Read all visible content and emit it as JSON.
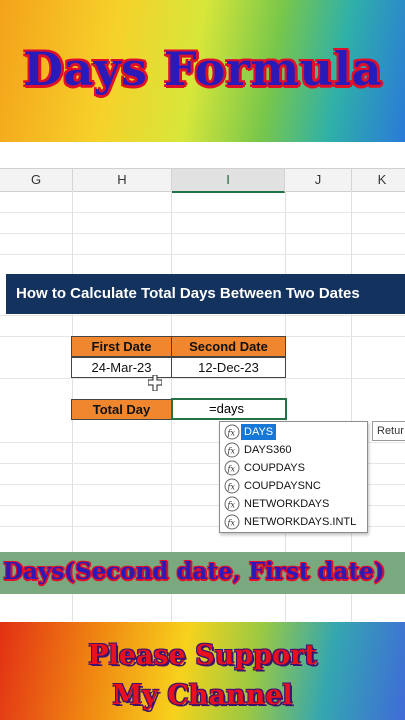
{
  "banner_top": {
    "title": "Days Formula"
  },
  "sheet": {
    "columns": [
      {
        "label": "G"
      },
      {
        "label": "H"
      },
      {
        "label": "I",
        "active": true
      },
      {
        "label": "J"
      },
      {
        "label": "K"
      }
    ],
    "title_band": "How to Calculate Total Days Between Two Dates",
    "first_date_header": "First Date",
    "second_date_header": "Second Date",
    "first_date_value": "24-Mar-23",
    "second_date_value": "12-Dec-23",
    "total_day_label": "Total Day",
    "formula_input": "=days"
  },
  "autocomplete": {
    "items": [
      {
        "label": "DAYS",
        "selected": true
      },
      {
        "label": "DAYS360"
      },
      {
        "label": "COUPDAYS"
      },
      {
        "label": "COUPDAYSNC"
      },
      {
        "label": "NETWORKDAYS"
      },
      {
        "label": "NETWORKDAYS.INTL"
      }
    ],
    "tooltip": "Retur",
    "icon": "function-icon"
  },
  "formula_hint": "Days(Second date, First date)",
  "banner_bottom": {
    "line1": "Please Support",
    "line2": "My Channel"
  },
  "colors": {
    "header_orange": "#f0862e",
    "title_navy": "#13325e",
    "excel_green": "#217346",
    "select_blue": "#1677d6"
  }
}
